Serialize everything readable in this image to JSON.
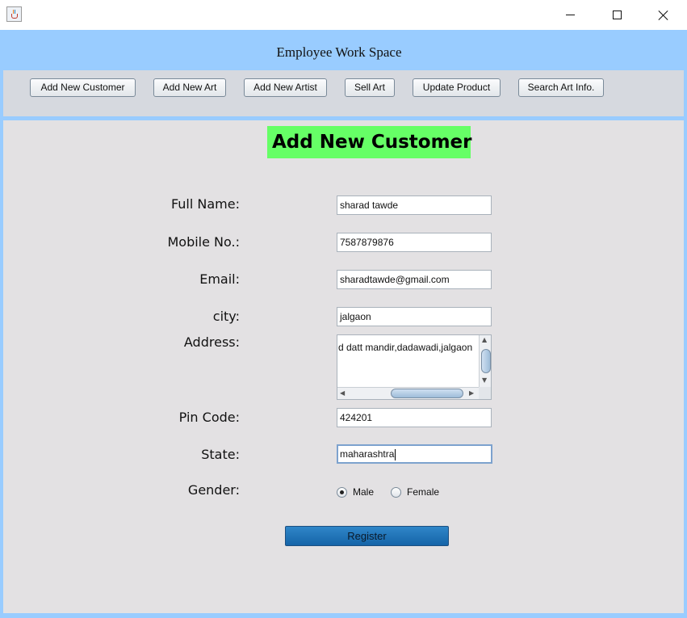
{
  "titlebar": {
    "app_icon": "java-cup-icon"
  },
  "header": {
    "title": "Employee Work Space"
  },
  "toolbar": {
    "buttons": [
      {
        "label": "Add New Customer"
      },
      {
        "label": "Add New Art"
      },
      {
        "label": "Add New Artist"
      },
      {
        "label": "Sell Art"
      },
      {
        "label": "Update Product"
      },
      {
        "label": "Search Art Info."
      }
    ]
  },
  "form": {
    "heading": "Add New Customer",
    "heading_bg": "#66ff66",
    "fields": {
      "full_name": {
        "label": "Full Name:",
        "value": "sharad tawde"
      },
      "mobile": {
        "label": "Mobile No.:",
        "value": "7587879876"
      },
      "email": {
        "label": "Email:",
        "value": "sharadtawde@gmail.com"
      },
      "city": {
        "label": "city:",
        "value": "jalgaon"
      },
      "address": {
        "label": "Address:",
        "value": "d datt mandir,dadawadi,jalgaon"
      },
      "pin_code": {
        "label": "Pin Code:",
        "value": "424201"
      },
      "state": {
        "label": "State:",
        "value": "maharashtra"
      }
    },
    "gender": {
      "label": "Gender:",
      "options": [
        {
          "label": "Male",
          "checked": true
        },
        {
          "label": "Female",
          "checked": false
        }
      ]
    },
    "register_label": "Register"
  },
  "colors": {
    "window_bg": "#99ccff",
    "toolbar_bg": "#d6d9df",
    "panel_bg": "#e3e1e3",
    "register_bg": "#1f75bb"
  }
}
